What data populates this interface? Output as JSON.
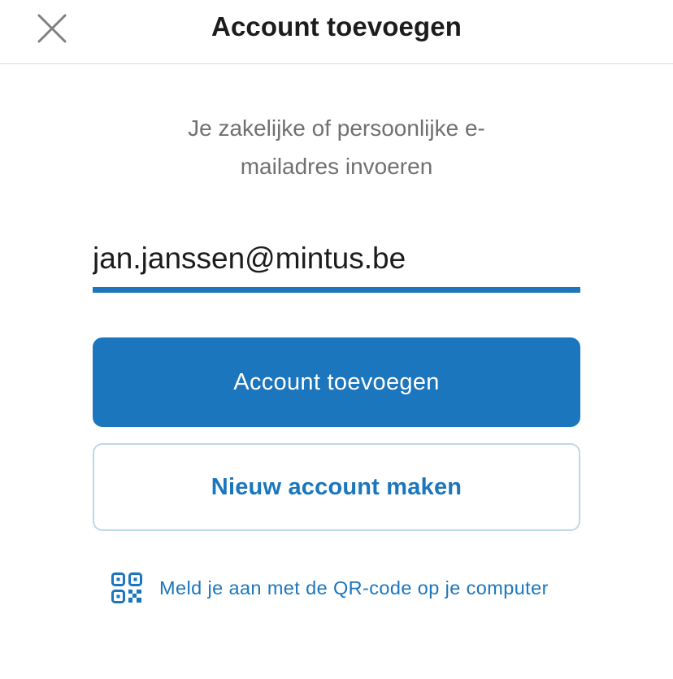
{
  "header": {
    "title": "Account toevoegen",
    "close_icon": "close-icon"
  },
  "instruction": {
    "line1": "Je zakelijke of persoonlijke e-",
    "line2": "mailadres invoeren"
  },
  "email": {
    "value": "jan.janssen@mintus.be"
  },
  "buttons": {
    "primary_label": "Account toevoegen",
    "secondary_label": "Nieuw account maken"
  },
  "qr": {
    "icon": "qr-code-icon",
    "label": "Meld je aan met de QR-code op je computer"
  },
  "colors": {
    "accent": "#1b76bd",
    "secondary_border": "#bcd8ec",
    "instruction_text": "#707070",
    "divider": "#dcdcdc"
  }
}
